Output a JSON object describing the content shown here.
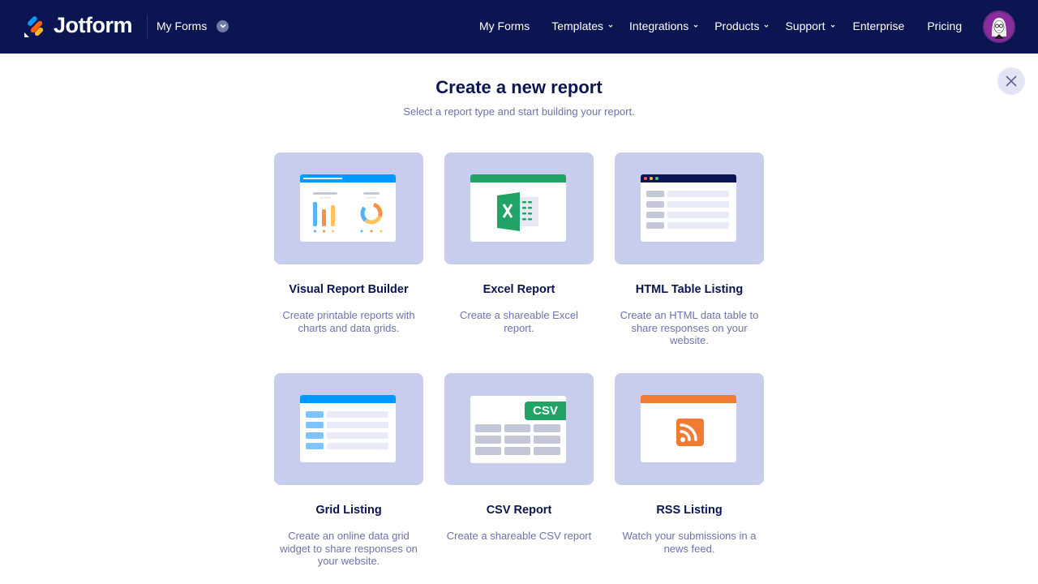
{
  "header": {
    "brand": "Jotform",
    "my_forms_dropdown": "My Forms",
    "nav": [
      {
        "label": "My Forms",
        "has_caret": false
      },
      {
        "label": "Templates",
        "has_caret": true
      },
      {
        "label": "Integrations",
        "has_caret": true
      },
      {
        "label": "Products",
        "has_caret": true
      },
      {
        "label": "Support",
        "has_caret": true
      },
      {
        "label": "Enterprise",
        "has_caret": false
      },
      {
        "label": "Pricing",
        "has_caret": false
      }
    ],
    "avatar_icon": "user-avatar"
  },
  "page": {
    "title": "Create a new report",
    "subtitle": "Select a report type and start building your report.",
    "close_icon": "close-icon"
  },
  "reports": [
    {
      "name": "Visual Report Builder",
      "description": "Create printable reports with charts and data grids.",
      "icon": "chart-dashboard-icon",
      "accent": "#0099ff"
    },
    {
      "name": "Excel Report",
      "description": "Create a shareable Excel report.",
      "icon": "excel-icon",
      "accent": "#21a366"
    },
    {
      "name": "HTML Table Listing",
      "description": "Create an HTML data table to share responses on your website.",
      "icon": "html-table-icon",
      "accent": "#0a1551"
    },
    {
      "name": "Grid Listing",
      "description": "Create an online data grid widget to share responses on your website.",
      "icon": "grid-icon",
      "accent": "#0099ff"
    },
    {
      "name": "CSV Report",
      "description": "Create a shareable CSV report",
      "icon": "csv-icon",
      "accent": "#21a366",
      "badge": "CSV"
    },
    {
      "name": "RSS Listing",
      "description": "Watch your submissions in a news feed.",
      "icon": "rss-icon",
      "accent": "#f07c33"
    }
  ],
  "colors": {
    "header_bg": "#0a1551",
    "tile_bg": "#c8cdee",
    "title": "#0a1551",
    "muted_text": "#6c73a8"
  }
}
